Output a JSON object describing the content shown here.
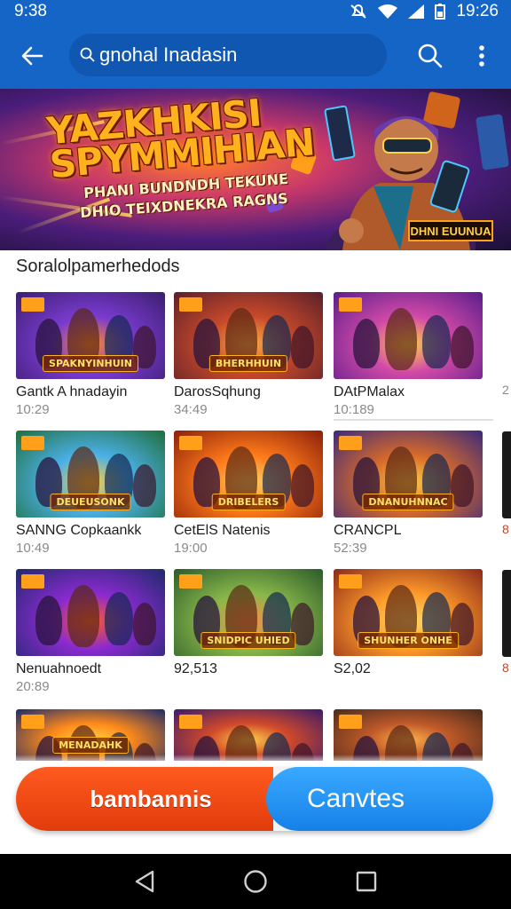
{
  "status_bar": {
    "time_left": "9:38",
    "time_right": "19:26"
  },
  "app_bar": {
    "search_text": "gnohal Inadasin"
  },
  "banner": {
    "title_line1": "YAZKHKISI",
    "title_line2": "SPYMMIHIAN",
    "sub_line1": "PHANI BUNDNDH TEKUNE",
    "sub_line2": "DHIO TEIXDNEKRA RAGNS",
    "tag": "DHNI EUUNUA"
  },
  "section": {
    "title": "Soralolpamerhedods"
  },
  "tiles": [
    {
      "name": "Gantk A hnadayin",
      "sub": "10:29",
      "badge": "SPAKNYINHUIN",
      "colors": [
        "#3b1e6e",
        "#7a3bd0",
        "#ff8a2a"
      ]
    },
    {
      "name": "DarosSqhung",
      "sub": "34:49",
      "badge": "BHERHHUIN",
      "colors": [
        "#5a1f2a",
        "#c94a2a",
        "#ffb347"
      ]
    },
    {
      "name": "DAtPMalax",
      "sub": "10:189",
      "badge": "",
      "colors": [
        "#5a1d8a",
        "#d24aa8",
        "#ffd24a"
      ]
    },
    {
      "name": "SANNG Copkaankk",
      "sub": "10:49",
      "badge": "DEUEUSONK",
      "colors": [
        "#1f6e3a",
        "#4cb0e8",
        "#ffcf3a"
      ]
    },
    {
      "name": "CetElS Natenis",
      "sub": "19:00",
      "badge": "DRIBELERS",
      "colors": [
        "#8a1f0a",
        "#ff7a1a",
        "#ffd86a"
      ]
    },
    {
      "name": "CRANCPL",
      "sub": "52:39",
      "badge": "DNANUHNNAC",
      "colors": [
        "#3a2a7a",
        "#d86a2a",
        "#ffd24a"
      ]
    },
    {
      "name": "Nenuahnoedt",
      "sub": "20:89",
      "badge": "",
      "colors": [
        "#1e2a6a",
        "#8a2ad0",
        "#ff5a2a"
      ]
    },
    {
      "name": "92,513",
      "sub": "",
      "badge": "SNIDPIC UHIED",
      "colors": [
        "#2a5a2a",
        "#8ab84a",
        "#ff8a4a"
      ]
    },
    {
      "name": "S2,02",
      "sub": "",
      "badge": "SHUNHER ONHE",
      "colors": [
        "#8a2a1a",
        "#ff9a2a",
        "#ffe06a"
      ]
    },
    {
      "name": "",
      "sub": "",
      "badge": "MENADAHK",
      "colors": [
        "#1a2a6a",
        "#ff8a1a",
        "#ffd24a"
      ]
    },
    {
      "name": "",
      "sub": "",
      "badge": "",
      "colors": [
        "#3a1a6a",
        "#d24a2a",
        "#ffd24a"
      ]
    },
    {
      "name": "",
      "sub": "",
      "badge": "",
      "colors": [
        "#4a2a1a",
        "#c05a2a",
        "#ffb24a"
      ]
    }
  ],
  "peek_items": [
    {
      "text": "2"
    },
    {
      "text": "8"
    },
    {
      "text": "8"
    }
  ],
  "toggle": {
    "left_label": "bambannis",
    "right_label": "Canvtes"
  }
}
